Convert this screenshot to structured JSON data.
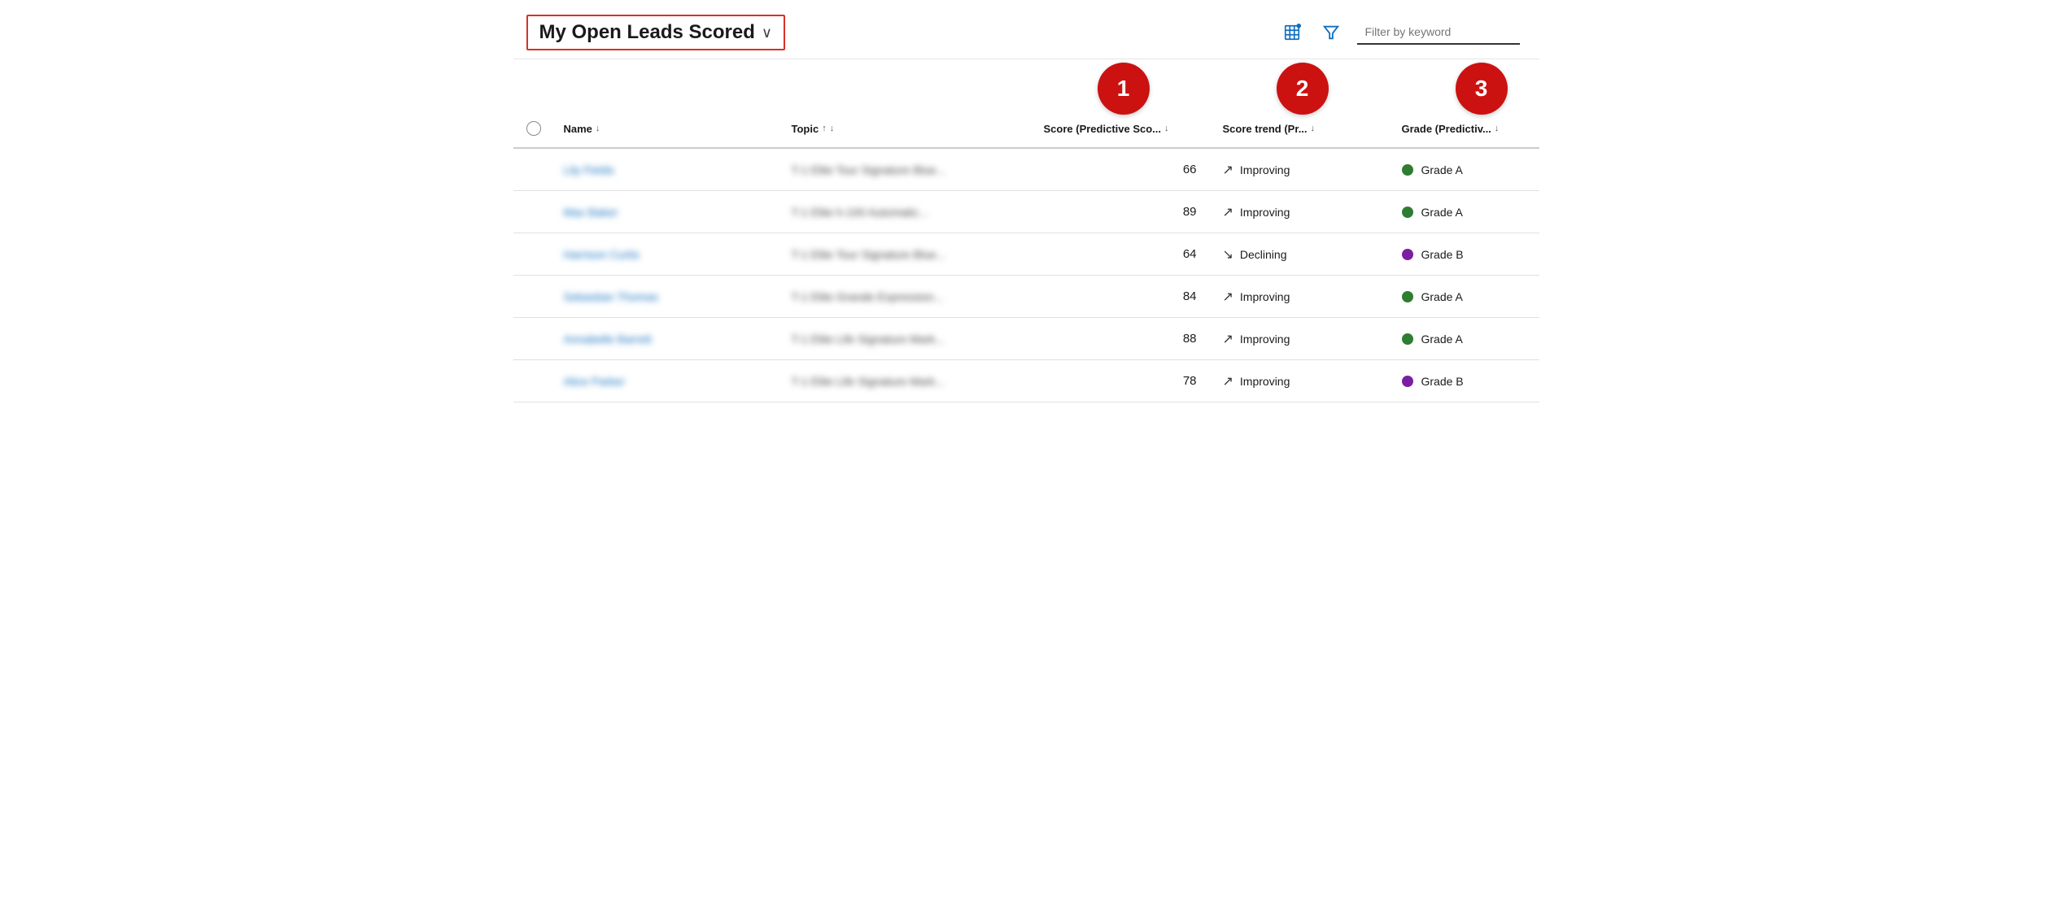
{
  "header": {
    "title": "My Open Leads Scored",
    "chevron": "∨",
    "filter_placeholder": "Filter by keyword"
  },
  "toolbar": {
    "cols_icon_label": "columns-icon",
    "filter_icon_label": "filter-icon"
  },
  "annotations": [
    {
      "number": "1"
    },
    {
      "number": "2"
    },
    {
      "number": "3"
    }
  ],
  "columns": [
    {
      "id": "checkbox",
      "label": ""
    },
    {
      "id": "name",
      "label": "Name",
      "sort": "↓"
    },
    {
      "id": "topic",
      "label": "Topic",
      "sort": "↑↓"
    },
    {
      "id": "score",
      "label": "Score (Predictive Sco...",
      "sort": "↓"
    },
    {
      "id": "trend",
      "label": "Score trend (Pr...",
      "sort": "↓"
    },
    {
      "id": "grade",
      "label": "Grade (Predictiv...",
      "sort": "↓"
    }
  ],
  "rows": [
    {
      "name": "Lily Fields",
      "topic": "T-1 Elite Tour Signature Blue...",
      "score": 66,
      "trend_direction": "up",
      "trend_label": "Improving",
      "grade_color": "green",
      "grade_label": "Grade A"
    },
    {
      "name": "Max Baker",
      "topic": "T-1 Elite h-100 Automatic...",
      "score": 89,
      "trend_direction": "up",
      "trend_label": "Improving",
      "grade_color": "green",
      "grade_label": "Grade A"
    },
    {
      "name": "Harrison Curtis",
      "topic": "T-1 Elite Tour Signature Blue...",
      "score": 64,
      "trend_direction": "down",
      "trend_label": "Declining",
      "grade_color": "purple",
      "grade_label": "Grade B"
    },
    {
      "name": "Sebastian Thomas",
      "topic": "T-1 Elite Grande Expression...",
      "score": 84,
      "trend_direction": "up",
      "trend_label": "Improving",
      "grade_color": "green",
      "grade_label": "Grade A"
    },
    {
      "name": "Annabelle Barrett",
      "topic": "T-1 Elite Life Signature Mark...",
      "score": 88,
      "trend_direction": "up",
      "trend_label": "Improving",
      "grade_color": "green",
      "grade_label": "Grade A"
    },
    {
      "name": "Alice Parker",
      "topic": "T-1 Elite Life Signature Mark...",
      "score": 78,
      "trend_direction": "up",
      "trend_label": "Improving",
      "grade_color": "purple",
      "grade_label": "Grade B"
    }
  ]
}
